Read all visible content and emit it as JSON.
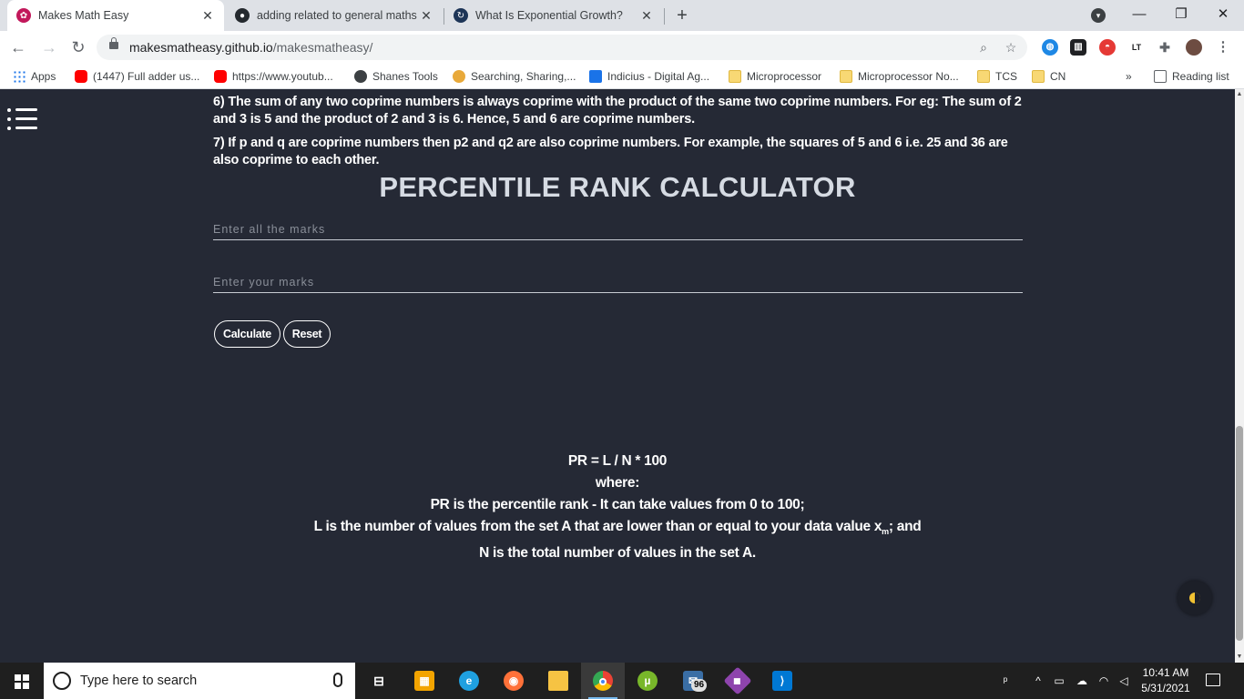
{
  "browser": {
    "tabs": [
      {
        "title": "Makes Math Easy",
        "active": true,
        "icon": "makesmath-favicon"
      },
      {
        "title": "adding related to general maths",
        "active": false,
        "icon": "github-icon"
      },
      {
        "title": "What Is Exponential Growth?",
        "active": false,
        "icon": "site-favicon"
      }
    ],
    "new_tab_label": "+",
    "url": {
      "host": "makesmatheasy.github.io",
      "path": "/makesmatheasy/"
    },
    "bookmarks": [
      {
        "label": "Apps",
        "icon": "apps-grid-icon"
      },
      {
        "label": "(1447) Full adder us...",
        "icon": "youtube-icon"
      },
      {
        "label": "https://www.youtub...",
        "icon": "youtube-icon"
      },
      {
        "label": "Shanes Tools",
        "icon": "globe-icon"
      },
      {
        "label": "Searching, Sharing,...",
        "icon": "star-icon"
      },
      {
        "label": "Indicius - Digital Ag...",
        "icon": "indicius-icon"
      },
      {
        "label": "Microprocessor",
        "icon": "folder-icon"
      },
      {
        "label": "Microprocessor No...",
        "icon": "folder-icon"
      },
      {
        "label": "TCS",
        "icon": "folder-icon"
      },
      {
        "label": "CN",
        "icon": "folder-icon"
      }
    ],
    "bookmarks_overflow": "»",
    "reading_list": "Reading list",
    "ext_lt": "LT"
  },
  "content": {
    "paragraphs": [
      "6) The sum of any two coprime numbers is always coprime with the product of the same two coprime numbers. For eg: The sum of 2 and 3 is 5 and the product of 2 and 3 is 6. Hence, 5 and 6 are coprime numbers.",
      "7) If p and q are coprime numbers then p2 and q2 are also coprime numbers. For example, the squares of 5 and 6 i.e. 25 and 36 are also coprime to each other."
    ],
    "calculator_title": "PERCENTILE RANK CALCULATOR",
    "all_marks_placeholder": "Enter all the marks",
    "your_marks_placeholder": "Enter your marks",
    "calculate_label": "Calculate",
    "reset_label": "Reset",
    "formula": {
      "line1": "PR = L / N * 100",
      "line2": "where:",
      "line3": "PR is the percentile rank - It can take values from 0 to 100;",
      "line4_pre": "L is the number of values from the set A that are lower than or equal to your data value x",
      "line4_sub": "m",
      "line4_post": "; and",
      "line5": "N is the total number of values in the set A."
    }
  },
  "taskbar": {
    "search_placeholder": "Type here to search",
    "mail_badge": "96",
    "time": "10:41 AM",
    "date": "5/31/2021"
  },
  "colors": {
    "page_bg": "#252935",
    "text": "#ffffff",
    "title": "#d6dbe3",
    "moon": "#f1c232"
  }
}
